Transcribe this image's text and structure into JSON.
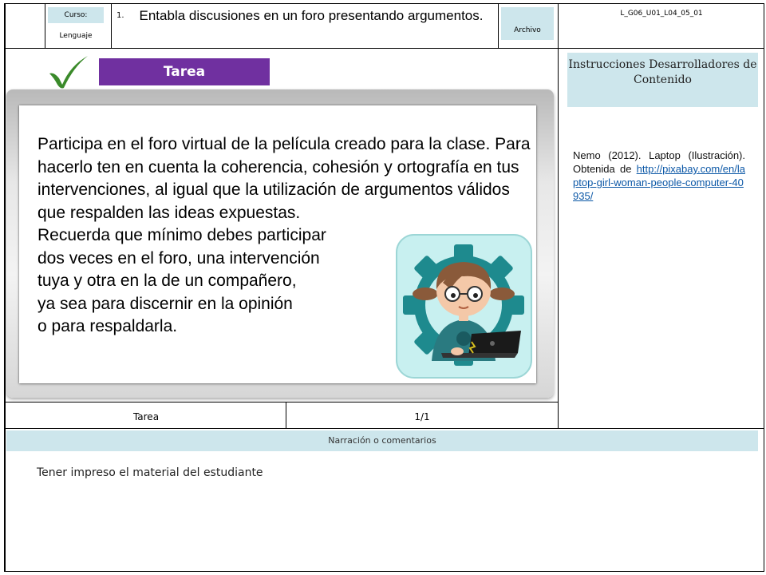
{
  "header": {
    "curso_label": "Curso:",
    "curso_value": "Lenguaje",
    "item_number": "1.",
    "title": "Entabla discusiones en un foro presentando argumentos.",
    "archivo_label": "Archivo",
    "code": "L_G06_U01_L04_05_01"
  },
  "task": {
    "tab_label": "Tarea",
    "paragraph_1": "Participa en el foro virtual de la película creado para la clase. Para hacerlo ten en cuenta  la coherencia, cohesión y ortografía en tus intervenciones, al igual que la utilización de argumentos válidos que respalden las ideas expuestas.",
    "paragraph_2_lines": [
      "Recuerda que mínimo debes participar",
      "dos veces en el foro, una intervención",
      "tuya y otra en la de un compañero,",
      "ya sea para discernir en la opinión",
      "o para respaldarla."
    ]
  },
  "sidebar": {
    "instructions_title": "Instrucciones Desarrolladores de Contenido",
    "credit_text": "Nemo (2012). Laptop (Ilustración). Obtenida de",
    "credit_link": "http://pixabay.com/en/laptop-girl-woman-people-computer-40935/"
  },
  "footer": {
    "type_label": "Tarea",
    "page_label": "1/1",
    "narration_header": "Narración o comentarios",
    "narration_text": "Tener impreso el material del estudiante"
  },
  "colors": {
    "header_box": "#cde6ec",
    "tab_purple": "#7030a0",
    "check_green": "#3a8a2a",
    "illustration_bg": "#c8f0f0",
    "gear": "#1e8a8e"
  },
  "icons": [
    "checkmark-icon",
    "girl-laptop-illustration"
  ]
}
